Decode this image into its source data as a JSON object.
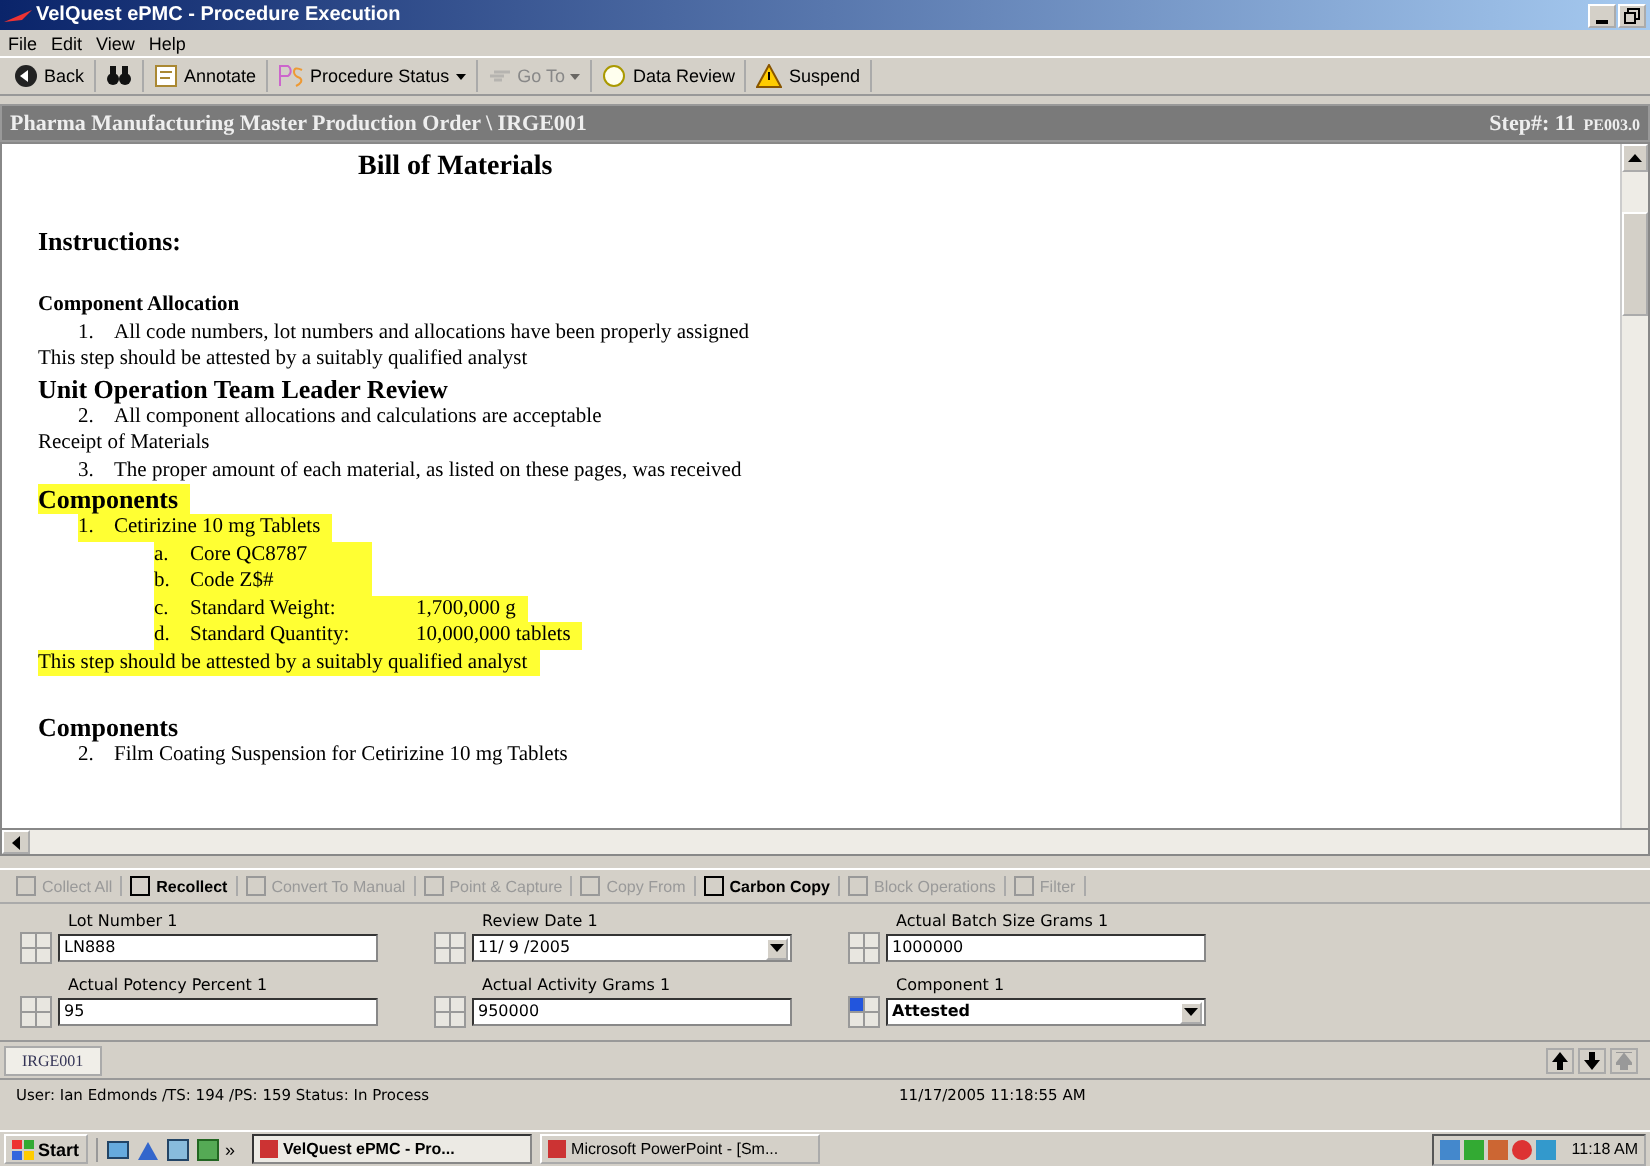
{
  "window": {
    "title": "VelQuest ePMC - Procedure Execution"
  },
  "menu": [
    "File",
    "Edit",
    "View",
    "Help"
  ],
  "toolbar": [
    {
      "label": "Back",
      "disabled": false
    },
    {
      "disabled": false
    },
    {
      "label": "Annotate",
      "disabled": false
    },
    {
      "label": "Procedure Status",
      "dropdown": true,
      "disabled": false
    },
    {
      "label": "Go To",
      "dropdown": true,
      "disabled": true
    },
    {
      "label": "Data Review",
      "disabled": false
    },
    {
      "label": "Suspend",
      "disabled": false
    }
  ],
  "header": {
    "title": "Pharma Manufacturing Master Production Order \\ IRGE001",
    "step": "Step#: 11",
    "code": "PE003.0"
  },
  "document": {
    "heading": "Bill of Materials",
    "lines": [
      {
        "kind": "section",
        "text": "Instructions:",
        "highlighted": false
      },
      {
        "kind": "subhead",
        "text": "Component Allocation",
        "highlighted": false
      },
      {
        "kind": "numbered",
        "number": "1.",
        "text": "All code numbers, lot numbers and allocations have been properly assigned",
        "highlighted": false
      },
      {
        "kind": "plain",
        "text": "This step should be attested by a suitably qualified analyst",
        "highlighted": false
      },
      {
        "kind": "major",
        "text": "Unit Operation Team Leader Review",
        "highlighted": false
      },
      {
        "kind": "numbered",
        "number": "2.",
        "text": "All component allocations and calculations are acceptable",
        "highlighted": false
      },
      {
        "kind": "plain",
        "text": "Receipt of Materials",
        "highlighted": false
      },
      {
        "kind": "numbered",
        "number": "3.",
        "text": "The proper amount of each material, as listed on these pages, was received",
        "highlighted": false
      },
      {
        "kind": "major",
        "text": "Components",
        "highlighted": true
      },
      {
        "kind": "numbered",
        "number": "1.",
        "text": "Cetirizine 10 mg Tablets",
        "highlighted": true
      },
      {
        "kind": "lettered",
        "number": "a.",
        "text": "Core QC8787",
        "highlighted": true
      },
      {
        "kind": "lettered",
        "number": "b.",
        "text": "Code Z$#",
        "highlighted": true
      },
      {
        "kind": "lettered",
        "number": "c.",
        "text": "Standard Weight:",
        "value": "1,700,000 g",
        "highlighted": true
      },
      {
        "kind": "lettered",
        "number": "d.",
        "text": "Standard Quantity:",
        "value": "10,000,000 tablets",
        "highlighted": true
      },
      {
        "kind": "plain",
        "text": "This step should be attested by a suitably qualified analyst",
        "highlighted": true
      },
      {
        "kind": "gapmajor",
        "text": "Components",
        "highlighted": false
      },
      {
        "kind": "numbered",
        "number": "2.",
        "text": "Film Coating Suspension for Cetirizine 10 mg Tablets",
        "highlighted": false
      }
    ]
  },
  "actions": [
    {
      "label": "Collect All",
      "disabled": true
    },
    {
      "label": "Recollect",
      "disabled": false
    },
    {
      "label": "Convert To Manual",
      "disabled": true
    },
    {
      "label": "Point & Capture",
      "disabled": true
    },
    {
      "label": "Copy From",
      "disabled": true
    },
    {
      "label": "Carbon Copy",
      "disabled": false
    },
    {
      "label": "Block Operations",
      "disabled": true
    },
    {
      "label": "Filter",
      "disabled": true
    }
  ],
  "fields": [
    {
      "label": "Lot Number 1",
      "value": "LN888",
      "kind": "text",
      "attested": false
    },
    {
      "label": "Review Date 1",
      "value": "11/ 9 /2005",
      "kind": "dropdown",
      "attested": false
    },
    {
      "label": "Actual Batch Size Grams 1",
      "value": "1000000",
      "kind": "text",
      "attested": false
    },
    {
      "label": "Actual Potency Percent 1",
      "value": "95",
      "kind": "text",
      "attested": false
    },
    {
      "label": "Actual Activity Grams 1",
      "value": "950000",
      "kind": "text",
      "attested": false
    },
    {
      "label": "Component 1",
      "value": "Attested",
      "kind": "dropdown",
      "attested": true
    }
  ],
  "tabs": [
    {
      "label": "IRGE001",
      "selected": true
    }
  ],
  "status_bar": {
    "user": "User: Ian Edmonds /TS: 194 /PS: 159 Status: In Process",
    "datetime": "11/17/2005 11:18:55 AM"
  },
  "taskbar": {
    "start": "Start",
    "chevron": "»",
    "buttons": [
      {
        "label": "VelQuest ePMC - Pro...",
        "selected": true
      },
      {
        "label": "Microsoft PowerPoint - [Sm...",
        "selected": false
      }
    ],
    "clock": "11:18 AM"
  }
}
